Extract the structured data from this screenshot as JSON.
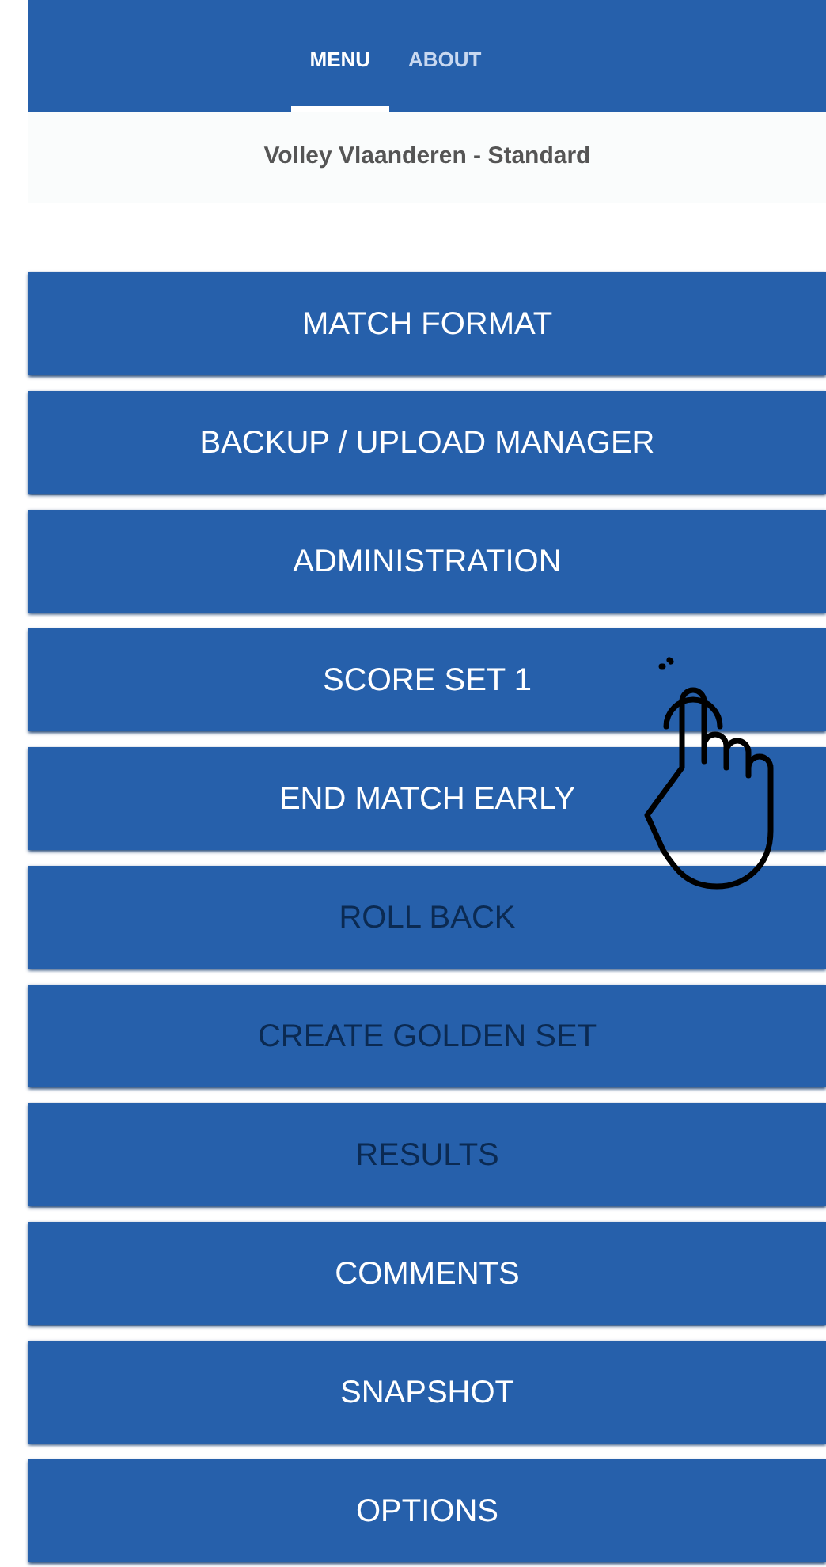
{
  "tabs": [
    {
      "label": "MENU",
      "selected": true
    },
    {
      "label": "ABOUT",
      "selected": false
    }
  ],
  "subtitle": "Volley Vlaanderen - Standard",
  "menu_items": [
    {
      "label": "MATCH FORMAT",
      "disabled": false
    },
    {
      "label": "BACKUP / UPLOAD MANAGER",
      "disabled": false
    },
    {
      "label": "ADMINISTRATION",
      "disabled": false
    },
    {
      "label": "SCORE SET 1",
      "disabled": false
    },
    {
      "label": "END MATCH EARLY",
      "disabled": false
    },
    {
      "label": "ROLL BACK",
      "disabled": true
    },
    {
      "label": "CREATE GOLDEN SET",
      "disabled": true
    },
    {
      "label": "RESULTS",
      "disabled": true
    },
    {
      "label": "COMMENTS",
      "disabled": false
    },
    {
      "label": "SNAPSHOT",
      "disabled": false
    },
    {
      "label": "OPTIONS",
      "disabled": false
    }
  ]
}
